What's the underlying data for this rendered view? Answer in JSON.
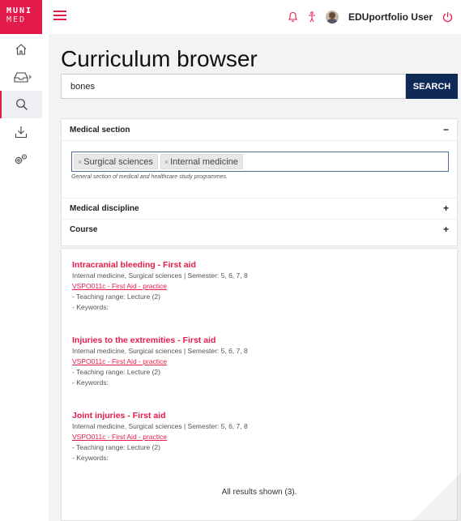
{
  "app": {
    "logo_line1": "MUNI",
    "logo_line2": "MED",
    "user_name": "EDUportfolio User"
  },
  "colors": {
    "accent": "#e31b4b",
    "search_button": "#0f2a57",
    "background": "#f3f3f3"
  },
  "icons": {
    "top": [
      "bell-icon",
      "accessibility-icon",
      "avatar",
      "power-icon"
    ],
    "nav": [
      "home-icon",
      "inbox-icon",
      "search-icon",
      "download-icon",
      "settings-icon"
    ]
  },
  "page": {
    "title": "Curriculum browser"
  },
  "search": {
    "value": "bones",
    "button_label": "SEARCH"
  },
  "filters": {
    "medical_section": {
      "label": "Medical section",
      "toggle": "−",
      "tags": [
        "Surgical sciences",
        "Internal medicine"
      ],
      "hint": "General section of medical and healthcare study programmes."
    },
    "medical_discipline": {
      "label": "Medical discipline",
      "toggle": "+"
    },
    "course": {
      "label": "Course",
      "toggle": "+"
    }
  },
  "results": {
    "items": [
      {
        "title": "Intracranial bleeding - First aid",
        "meta": "Internal medicine, Surgical sciences | Semester: 5, 6, 7, 8",
        "link": "VSPO011c - First Aid - practice",
        "teaching": "- Teaching range: Lecture (2)",
        "keywords": "- Keywords:"
      },
      {
        "title": "Injuries to the extremities - First aid",
        "meta": "Internal medicine, Surgical sciences | Semester: 5, 6, 7, 8",
        "link": "VSPO011c - First Aid - practice",
        "teaching": "- Teaching range: Lecture (2)",
        "keywords": "- Keywords:"
      },
      {
        "title": "Joint injuries - First aid",
        "meta": "Internal medicine, Surgical sciences | Semester: 5, 6, 7, 8",
        "link": "VSPO011c - First Aid - practice",
        "teaching": "- Teaching range: Lecture (2)",
        "keywords": "- Keywords:"
      }
    ],
    "summary": "All results shown (3)."
  }
}
